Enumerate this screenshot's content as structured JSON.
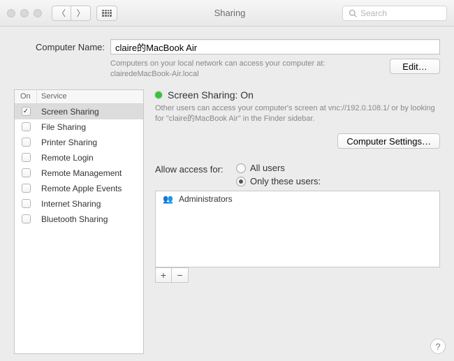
{
  "titlebar": {
    "title": "Sharing",
    "search_placeholder": "Search"
  },
  "naming": {
    "label": "Computer Name:",
    "value": "claire的MacBook Air",
    "note_line1": "Computers on your local network can access your computer at:",
    "note_line2": "clairedeMacBook-Air.local",
    "edit_label": "Edit…"
  },
  "services": {
    "header_on": "On",
    "header_service": "Service",
    "items": [
      {
        "label": "Screen Sharing",
        "checked": true,
        "selected": true
      },
      {
        "label": "File Sharing",
        "checked": false,
        "selected": false
      },
      {
        "label": "Printer Sharing",
        "checked": false,
        "selected": false
      },
      {
        "label": "Remote Login",
        "checked": false,
        "selected": false
      },
      {
        "label": "Remote Management",
        "checked": false,
        "selected": false
      },
      {
        "label": "Remote Apple Events",
        "checked": false,
        "selected": false
      },
      {
        "label": "Internet Sharing",
        "checked": false,
        "selected": false
      },
      {
        "label": "Bluetooth Sharing",
        "checked": false,
        "selected": false
      }
    ]
  },
  "detail": {
    "status_color": "#3bc13b",
    "status_label": "Screen Sharing: On",
    "desc": "Other users can access your computer's screen at vnc://192.0.108.1/ or by looking for \"claire的MacBook Air\" in the Finder sidebar.",
    "computer_settings_label": "Computer Settings…",
    "access_label": "Allow access for:",
    "radios": {
      "all": "All users",
      "only": "Only these users:",
      "selected": "only"
    },
    "users": [
      {
        "label": "Administrators"
      }
    ],
    "add_label": "+",
    "remove_label": "−"
  },
  "help": {
    "label": "?"
  }
}
